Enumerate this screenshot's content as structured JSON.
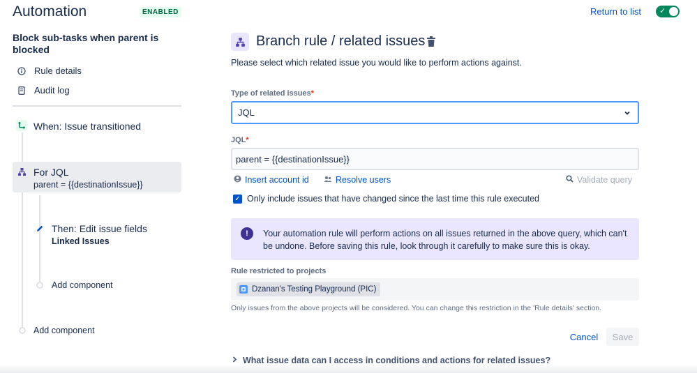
{
  "header": {
    "app_title": "Automation",
    "status_badge": "ENABLED",
    "return_link": "Return to list",
    "toggle_on": true,
    "colors": {
      "toggle": "#00875A",
      "badge_text": "#006644",
      "link": "#0052CC"
    }
  },
  "sidebar": {
    "rule_name": "Block sub-tasks when parent is blocked",
    "links": [
      {
        "label": "Rule details",
        "icon": "info-icon"
      },
      {
        "label": "Audit log",
        "icon": "document-icon"
      }
    ],
    "trigger": {
      "label": "When: Issue transitioned",
      "icon": "transition-icon"
    },
    "branch": {
      "label": "For JQL",
      "detail": "parent = {{destinationIssue}}",
      "icon": "branch-icon"
    },
    "action": {
      "label": "Then: Edit issue fields",
      "detail": "Linked Issues",
      "icon": "pencil-icon"
    },
    "add_component_inner": "Add component",
    "add_component_outer": "Add component"
  },
  "main": {
    "title": "Branch rule / related issues",
    "subtitle": "Please select which related issue you would like to perform actions against.",
    "type_label": "Type of related issues",
    "type_value": "JQL",
    "jql_label": "JQL",
    "jql_value": "parent = {{destinationIssue}}",
    "insert_account": "Insert account id",
    "resolve_users": "Resolve users",
    "validate_query": "Validate query",
    "only_include_checked": true,
    "only_include_label": "Only include issues that have changed since the last time this rule executed",
    "info_text": "Your automation rule will perform actions on all issues returned in the above query, which can't be undone. Before saving this rule, look through it carefully to make sure this is okay.",
    "restricted_label": "Rule restricted to projects",
    "project_name": "Dzanan's Testing Playground (PIC)",
    "restrict_note": "Only issues from the above projects will be considered. You can change this restriction in the 'Rule details' section.",
    "cancel": "Cancel",
    "save": "Save",
    "faq": "What issue data can I access in conditions and actions for related issues?"
  }
}
